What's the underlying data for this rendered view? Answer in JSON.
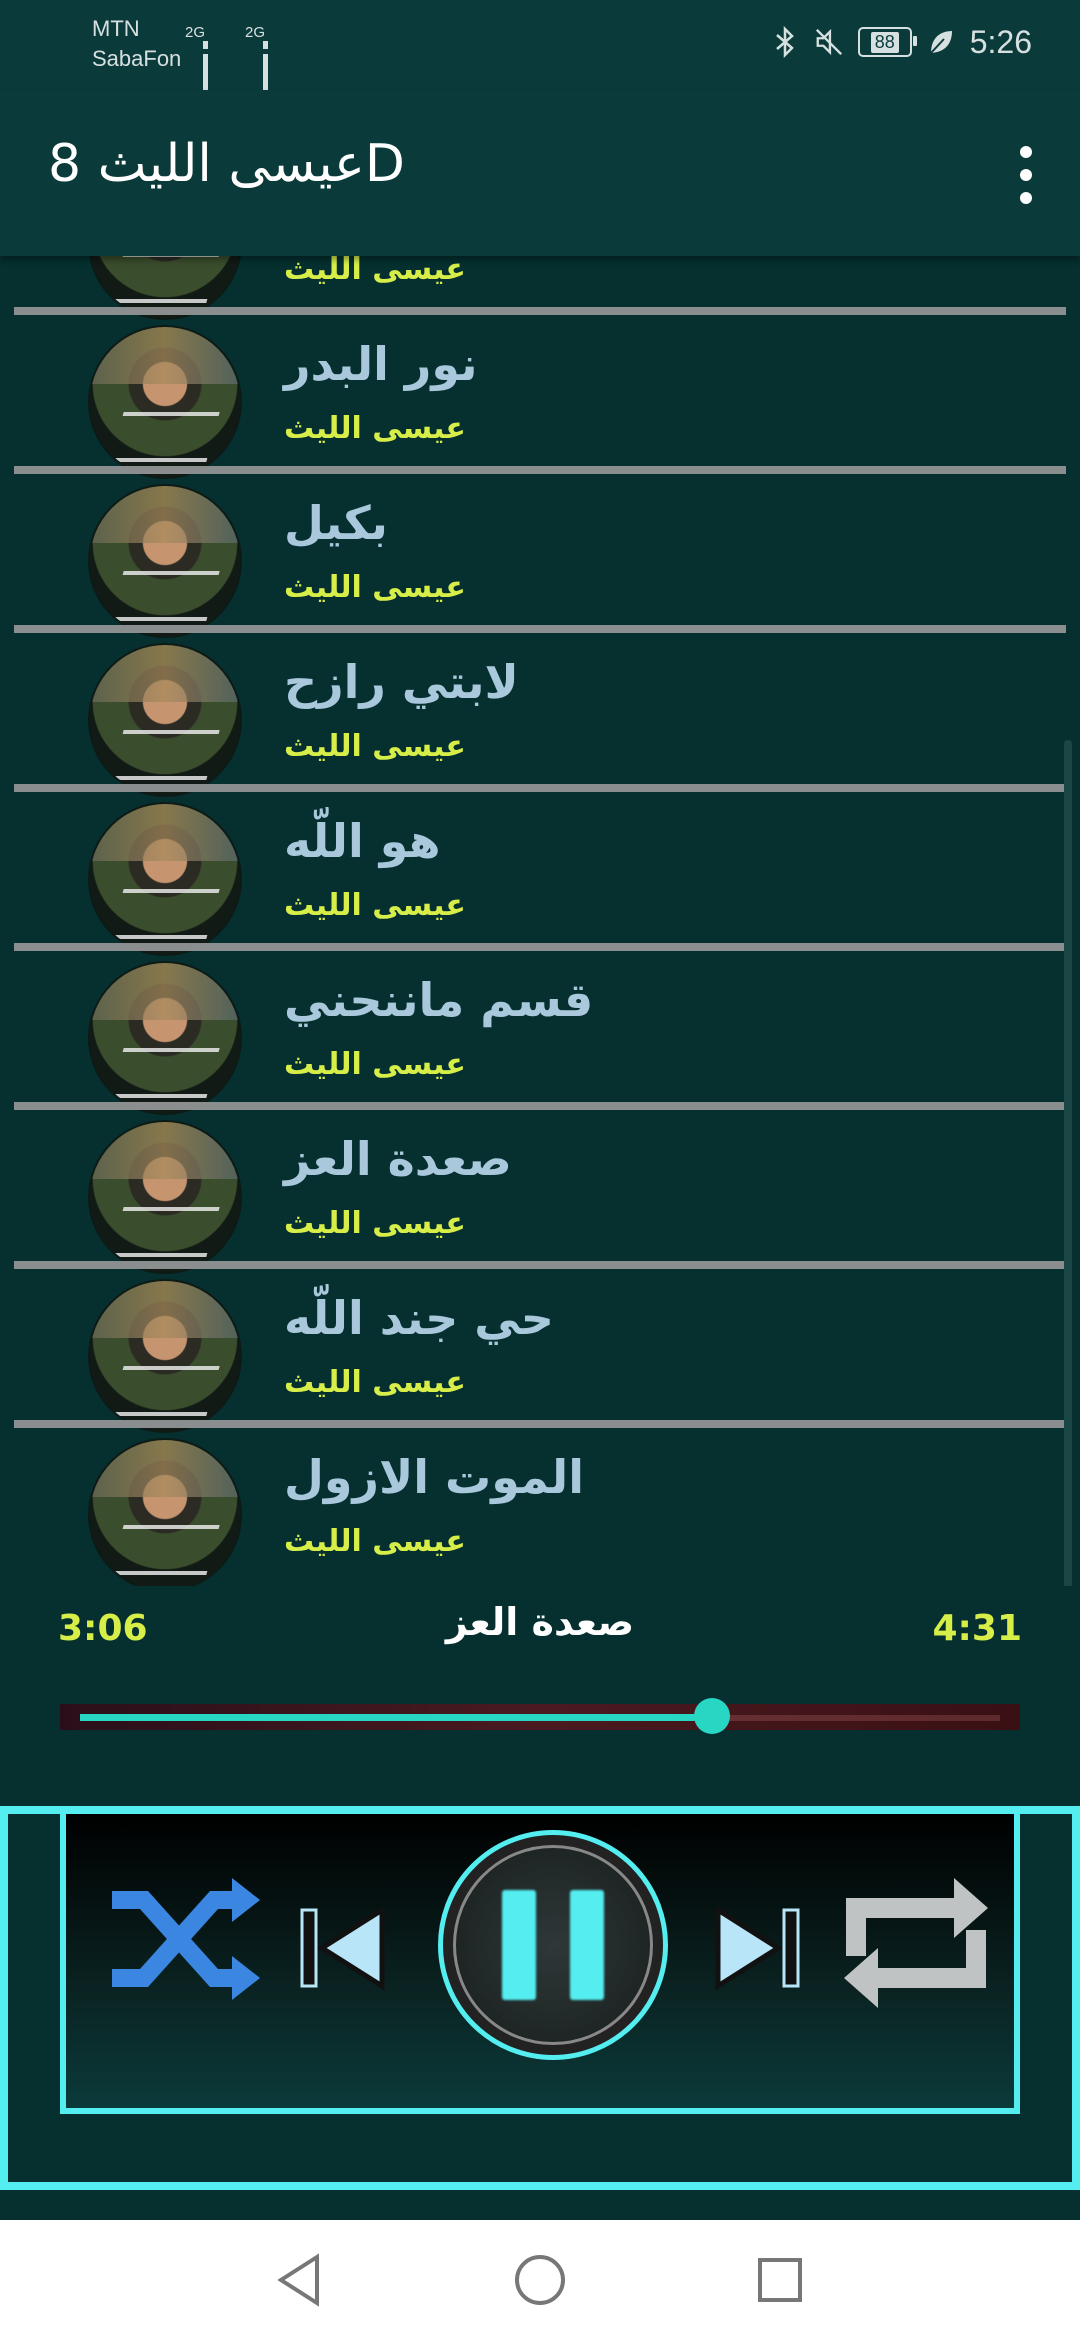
{
  "status_bar": {
    "carrier_line1": "MTN",
    "carrier_line2": "SabaFon",
    "signal1_tag": "2G",
    "signal2_tag": "2G",
    "battery": "88",
    "time": "5:26"
  },
  "app_bar": {
    "title": "عيسى الليث 8D",
    "more_icon": "more-vert-icon"
  },
  "songs": [
    {
      "title": "",
      "artist": "عيسى الليث"
    },
    {
      "title": "نور البدر",
      "artist": "عيسى الليث"
    },
    {
      "title": "بكيل",
      "artist": "عيسى الليث"
    },
    {
      "title": "لابتي رازح",
      "artist": "عيسى الليث"
    },
    {
      "title": "هو اللّه",
      "artist": "عيسى الليث"
    },
    {
      "title": "قسم ماننحني",
      "artist": "عيسى الليث"
    },
    {
      "title": "صعدة العز",
      "artist": "عيسى الليث"
    },
    {
      "title": "حي جند اللّه",
      "artist": "عيسى الليث"
    },
    {
      "title": "الموت الازول",
      "artist": "عيسى الليث"
    }
  ],
  "player": {
    "elapsed": "3:06",
    "total": "4:31",
    "current_title": "صعدة العز",
    "progress_fraction": 0.687
  },
  "colors": {
    "accent": "#54eef0",
    "artist_text": "#d7ee49",
    "title_text": "#a9c8dc",
    "background": "#05302f",
    "shuffle": "#3a86e0"
  },
  "controls": {
    "shuffle_icon": "shuffle-icon",
    "prev_icon": "skip-previous-icon",
    "play_pause_icon": "pause-icon",
    "next_icon": "skip-next-icon",
    "repeat_icon": "repeat-icon"
  },
  "nav_bar": {
    "back_icon": "back-icon",
    "home_icon": "home-icon",
    "recents_icon": "recents-icon"
  }
}
